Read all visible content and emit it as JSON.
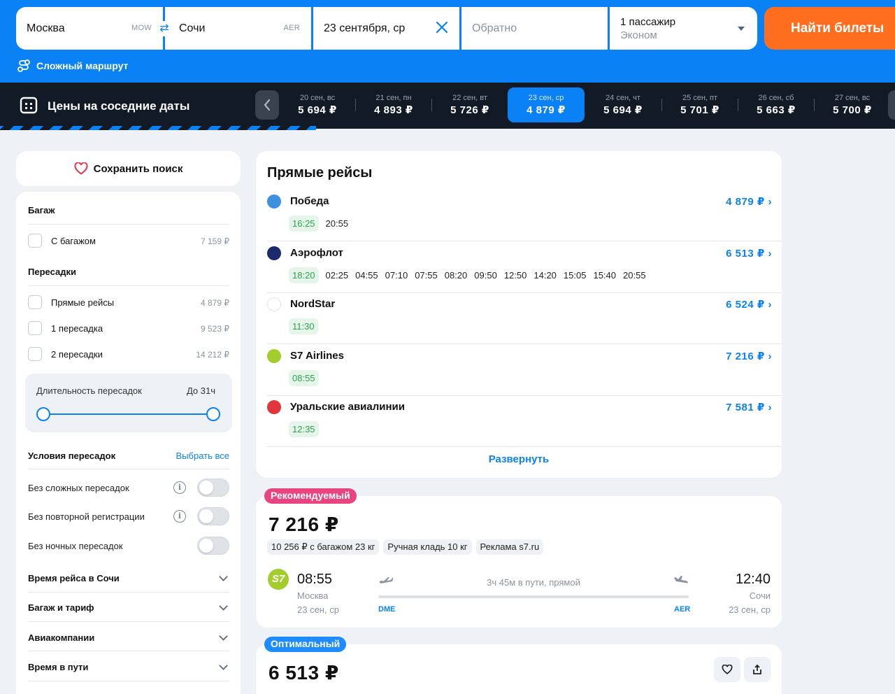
{
  "search": {
    "from": "Москва",
    "from_code": "MOW",
    "to": "Сочи",
    "to_code": "AER",
    "date": "23 сентября, ср",
    "return_placeholder": "Обратно",
    "passengers": "1 пассажир",
    "cabin": "Эконом",
    "find_label": "Найти билеты",
    "complex_route": "Сложный маршрут",
    "accent_color": "#0a82f5",
    "find_color": "#ff6d1f"
  },
  "dates": {
    "title": "Цены на соседние даты",
    "items": [
      {
        "label": "20 сен, вс",
        "price": "5 694 ₽"
      },
      {
        "label": "21 сен, пн",
        "price": "4 893 ₽"
      },
      {
        "label": "22 сен, вт",
        "price": "5 726 ₽"
      },
      {
        "label": "23 сен, ср",
        "price": "4 879 ₽",
        "active": true
      },
      {
        "label": "24 сен, чт",
        "price": "5 694 ₽"
      },
      {
        "label": "25 сен, пт",
        "price": "5 701 ₽"
      },
      {
        "label": "26 сен, сб",
        "price": "5 663 ₽"
      },
      {
        "label": "27 сен, вс",
        "price": "5 700 ₽"
      }
    ]
  },
  "sidebar": {
    "save_search": "Сохранить поиск",
    "baggage": {
      "title": "Багаж",
      "options": [
        {
          "label": "С багажом",
          "price": "7 159 ₽"
        }
      ]
    },
    "transfers": {
      "title": "Пересадки",
      "options": [
        {
          "label": "Прямые рейсы",
          "price": "4 879 ₽"
        },
        {
          "label": "1 пересадка",
          "price": "9 523 ₽"
        },
        {
          "label": "2 пересадки",
          "price": "14 212 ₽"
        }
      ]
    },
    "duration": {
      "label": "Длительность пересадок",
      "value": "До 31ч"
    },
    "conditions": {
      "title": "Условия пересадок",
      "select_all": "Выбрать все",
      "toggles": [
        {
          "label": "Без сложных пересадок",
          "info": true
        },
        {
          "label": "Без повторной регистрации",
          "info": true
        },
        {
          "label": "Без ночных пересадок",
          "info": false
        }
      ]
    },
    "sections": [
      "Время рейса в Сочи",
      "Багаж и тариф",
      "Авиакомпании",
      "Время в пути"
    ]
  },
  "direct": {
    "title": "Прямые рейсы",
    "expand": "Развернуть",
    "airlines": [
      {
        "name": "Победа",
        "price": "4 879 ₽",
        "times": [
          "16:25",
          "20:55"
        ],
        "logo_color": "#3d8fe0",
        "logo_icon": "pobeda-logo"
      },
      {
        "name": "Аэрофлот",
        "price": "6 513 ₽",
        "times": [
          "18:20",
          "02:25",
          "04:55",
          "07:10",
          "07:55",
          "08:20",
          "09:50",
          "12:50",
          "14:20",
          "15:05",
          "15:40",
          "20:55"
        ],
        "logo_color": "#1c2a6b",
        "logo_icon": "aeroflot-logo"
      },
      {
        "name": "NordStar",
        "price": "6 524 ₽",
        "times": [
          "11:30"
        ],
        "logo_color": "#ffffff",
        "logo_icon": "nordstar-logo"
      },
      {
        "name": "S7 Airlines",
        "price": "7 216 ₽",
        "times": [
          "08:55"
        ],
        "logo_color": "#a3cc2d",
        "logo_icon": "s7-logo"
      },
      {
        "name": "Уральские авиалинии",
        "price": "7 581 ₽",
        "times": [
          "12:35"
        ],
        "logo_color": "#e0353d",
        "logo_icon": "ural-logo"
      }
    ]
  },
  "tickets": [
    {
      "badge": "Рекомендуемый",
      "badge_color": "#e8457e",
      "price": "7 216 ₽",
      "chips": [
        "10 256 ₽ с багажом 23 кг",
        "Ручная кладь 10 кг",
        "Реклама s7.ru"
      ],
      "logo_text": "S7",
      "dep_time": "08:55",
      "dep_city": "Москва",
      "dep_date": "23 сен, ср",
      "dep_code": "DME",
      "arr_time": "12:40",
      "arr_city": "Сочи",
      "arr_date": "23 сен, ср",
      "arr_code": "AER",
      "duration": "3ч 45м в пути, прямой"
    },
    {
      "badge": "Оптимальный",
      "badge_color": "#1e8cff",
      "price": "6 513 ₽"
    }
  ]
}
